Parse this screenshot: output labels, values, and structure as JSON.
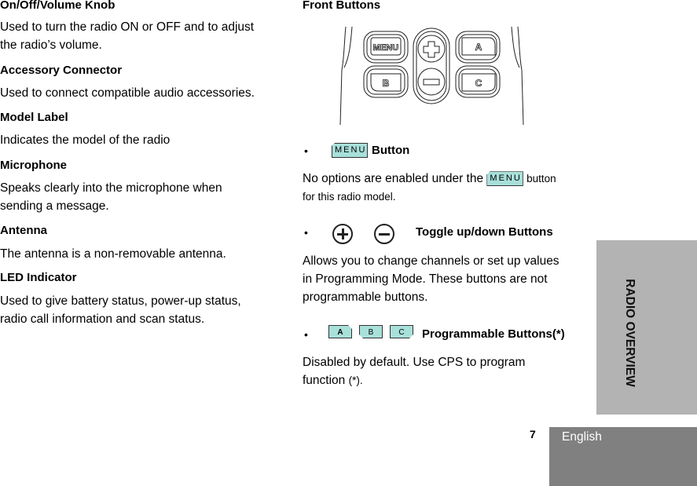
{
  "left_column": {
    "sections": [
      {
        "heading": "On/Off/Volume Knob",
        "lines": [
          "Used to turn the radio ON or OFF and to adjust",
          "the radio’s volume."
        ]
      },
      {
        "heading": "Accessory Connector",
        "lines": [
          "Used to connect compatible audio accessories."
        ]
      },
      {
        "heading": "Model Label",
        "lines": [
          "Indicates the model of the radio"
        ]
      },
      {
        "heading": "Microphone",
        "lines": [
          "Speaks clearly into the microphone when",
          "sending a message."
        ]
      },
      {
        "heading": "Antenna",
        "lines": [
          "The antenna is a non-removable antenna."
        ]
      },
      {
        "heading": "LED Indicator",
        "lines": [
          "Used to give battery status, power-up status,",
          "radio call information and scan status."
        ]
      }
    ]
  },
  "right_column": {
    "heading": "Front Buttons",
    "illustration": {
      "labels": [
        "MENU",
        "A",
        "B",
        "C",
        "+",
        "−"
      ],
      "icon": "radio-front-buttons-illustration"
    },
    "bullet": "•",
    "menu_item": {
      "icon_label": "MENU",
      "title": "Button",
      "text_before": "No options are enabled under the",
      "text_after": "button",
      "text_line2": "for this radio model."
    },
    "toggle_item": {
      "icons": [
        "plus-circle-icon",
        "minus-circle-icon"
      ],
      "title": "Toggle up/down Buttons",
      "lines": [
        "Allows you to change channels or set up values",
        "in Programming Mode. These buttons are not",
        "programmable buttons."
      ]
    },
    "programmable_item": {
      "button_labels": [
        "A",
        "B",
        "C"
      ],
      "title": "Programmable Buttons(*)",
      "line1": "Disabled by default. Use CPS to program",
      "line2_main": "function",
      "line2_note": "(*)."
    }
  },
  "side_tab": {
    "label": "RADIO OVERVIEW",
    "color": "#b3b3b3"
  },
  "footer": {
    "page_number": "7",
    "language": "English",
    "language_tab_color": "#808080"
  },
  "colors": {
    "button_fill": "#a8e0da"
  }
}
